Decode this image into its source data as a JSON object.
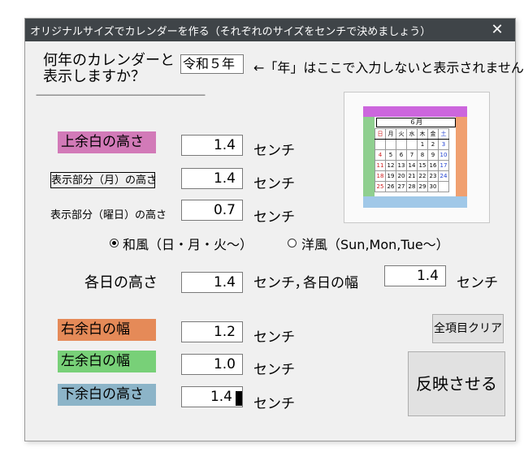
{
  "window": {
    "title": "オリジナルサイズでカレンダーを作る（それぞれのサイズをセンチで決めましょう）",
    "close_glyph": "✕"
  },
  "era": {
    "prompt_line1": "何年のカレンダーと",
    "prompt_line2": "表示しますか？",
    "value": "令和５年",
    "note": "←「年」はここで入力しないと表示されません。",
    "separator": "－－－－－－－－－－－－－－－－－－－－－－－－－－"
  },
  "fields": {
    "top_margin": {
      "label": "上余白の高さ",
      "value": "1.4",
      "unit": "センチ",
      "color": "#d27ab8"
    },
    "month_area": {
      "label": "表示部分（月）の高さ",
      "value": "1.4",
      "unit": "センチ"
    },
    "weekday_area": {
      "label": "表示部分（曜日）の高さ",
      "value": "0.7",
      "unit": "センチ"
    },
    "day_height": {
      "label": "各日の高さ",
      "value": "1.4",
      "unit": "センチ，"
    },
    "day_width": {
      "label": "各日の幅",
      "value": "1.4",
      "unit": "センチ"
    },
    "right_margin": {
      "label": "右余白の幅",
      "value": "1.2",
      "unit": "センチ",
      "color": "#e58a58"
    },
    "left_margin": {
      "label": "左余白の幅",
      "value": "1.0",
      "unit": "センチ",
      "color": "#78d078"
    },
    "bottom_margin": {
      "label": "下余白の高さ",
      "value": "1.4",
      "unit": "センチ",
      "color": "#8cb4c8"
    }
  },
  "style_options": {
    "japanese": {
      "label": "和風（日・月・火～）",
      "selected": true
    },
    "western": {
      "label": "洋風（Sun,Mon,Tue～）",
      "selected": false
    }
  },
  "buttons": {
    "clear_all": "全項目クリア",
    "apply": "反映させる"
  },
  "preview": {
    "month_label": "６月",
    "weekdays": [
      "日",
      "月",
      "火",
      "水",
      "木",
      "金",
      "土"
    ],
    "weeks": [
      [
        "",
        "",
        "",
        "",
        "1",
        "2",
        "3"
      ],
      [
        "4",
        "5",
        "6",
        "7",
        "8",
        "9",
        "10"
      ],
      [
        "11",
        "12",
        "13",
        "14",
        "15",
        "16",
        "17"
      ],
      [
        "18",
        "19",
        "20",
        "21",
        "22",
        "23",
        "24"
      ],
      [
        "25",
        "26",
        "27",
        "28",
        "29",
        "30",
        ""
      ]
    ],
    "colors": {
      "top": "#cc66dd",
      "left": "#8fcf8f",
      "right": "#f0a070",
      "bottom": "#a0c8e8"
    }
  }
}
